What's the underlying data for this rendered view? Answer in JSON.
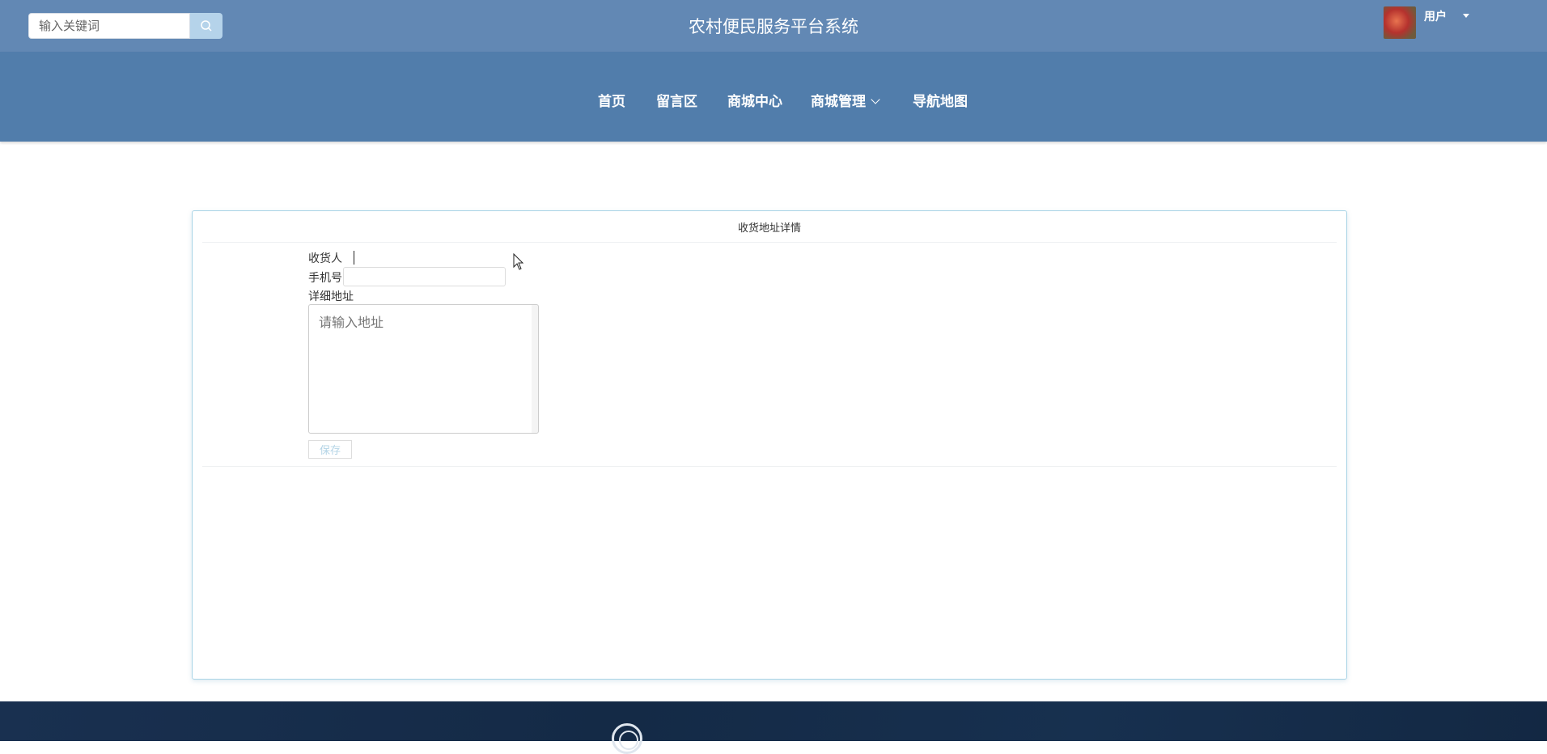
{
  "header": {
    "search_placeholder": "输入关键词",
    "title": "农村便民服务平台系统",
    "user": "用户"
  },
  "nav": {
    "items": [
      "首页",
      "留言区",
      "商城中心",
      "商城管理",
      "导航地图"
    ]
  },
  "form": {
    "title": "收货地址详情",
    "receiver_label": "收货人",
    "receiver_value": "",
    "phone_label": "手机号",
    "phone_value": "",
    "address_label": "详细地址",
    "address_placeholder": "请输入地址",
    "save_label": "保存"
  }
}
